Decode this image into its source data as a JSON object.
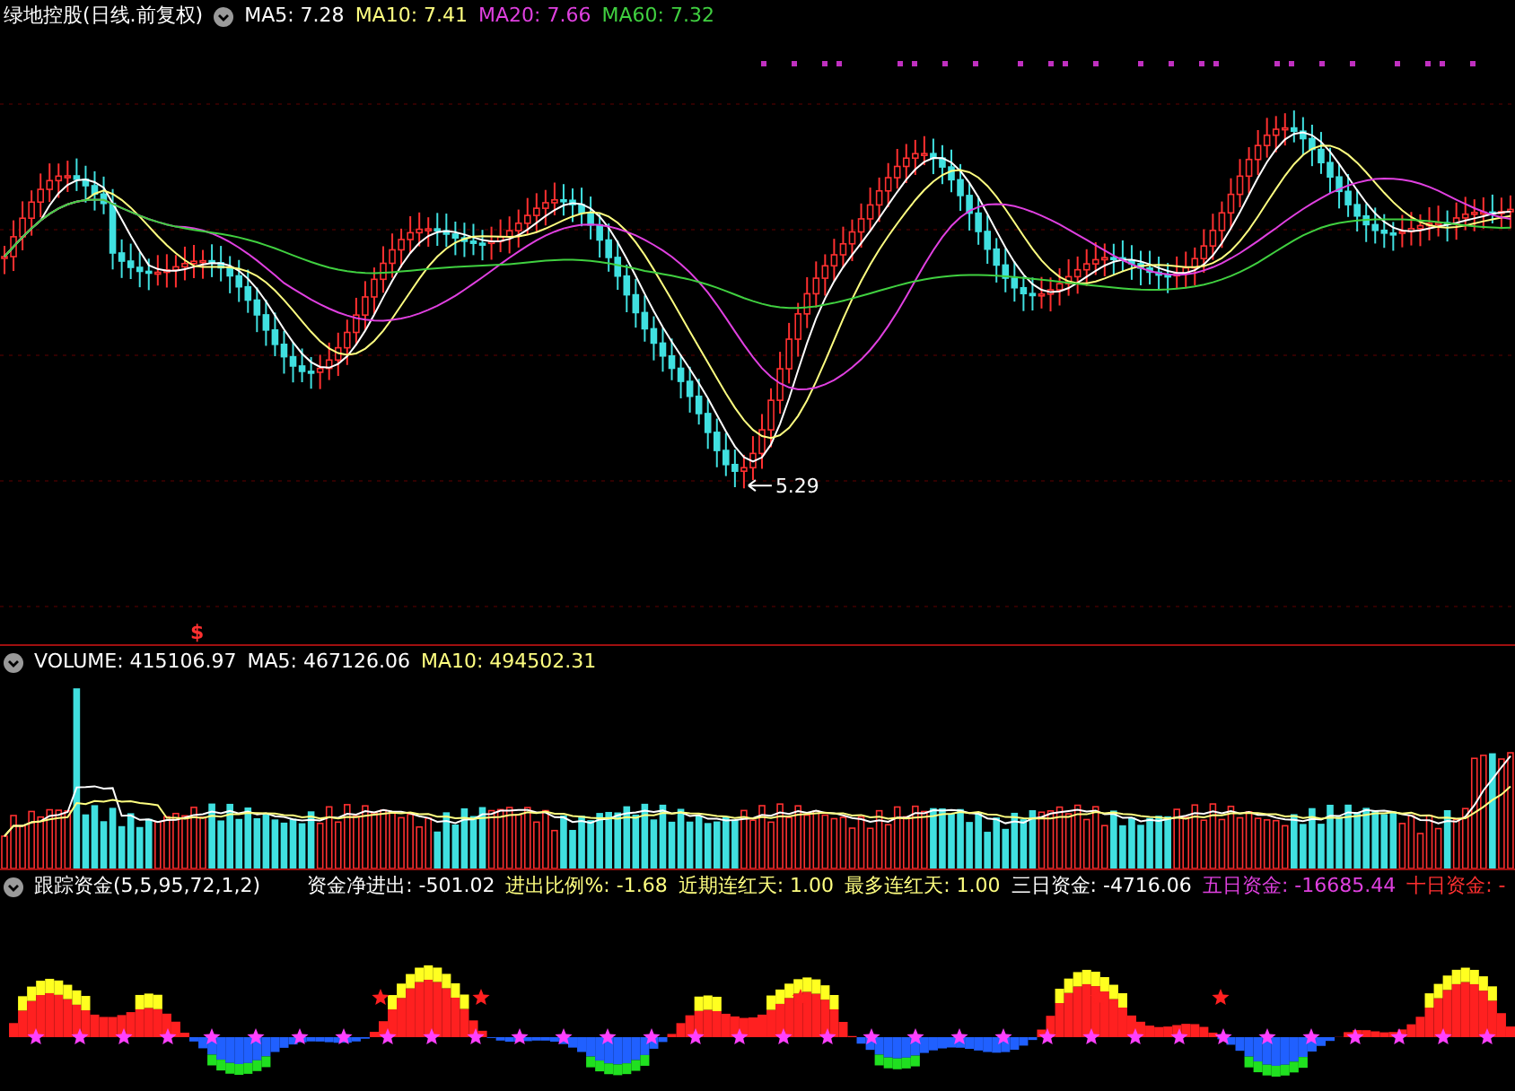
{
  "price_panel": {
    "title": "绿地控股(日线.前复权)",
    "indicators": [
      {
        "text": "MA5: 7.28",
        "color": "#ffffff"
      },
      {
        "text": "MA10: 7.41",
        "color": "#ffff80"
      },
      {
        "text": "MA20: 7.66",
        "color": "#e040e0"
      },
      {
        "text": "MA60: 7.32",
        "color": "#40d040"
      }
    ],
    "low_label": "5.29",
    "signal_mark": "$"
  },
  "volume_panel": {
    "indicators": [
      {
        "text": "VOLUME: 415106.97",
        "color": "#ffffff"
      },
      {
        "text": "MA5: 467126.06",
        "color": "#ffffff"
      },
      {
        "text": "MA10: 494502.31",
        "color": "#ffff80"
      }
    ]
  },
  "fund_panel": {
    "title": "跟踪资金(5,5,95,72,1,2)",
    "indicators": [
      {
        "text": "资金净进出: -501.02",
        "color": "#ffffff"
      },
      {
        "text": "进出比例%: -1.68",
        "color": "#ffff80"
      },
      {
        "text": "近期连红天: 1.00",
        "color": "#ffff80"
      },
      {
        "text": "最多连红天: 1.00",
        "color": "#ffff80"
      },
      {
        "text": "三日资金: -4716.06",
        "color": "#ffffff"
      },
      {
        "text": "五日资金: -16685.44",
        "color": "#e040e0"
      },
      {
        "text": "十日资金: -",
        "color": "#ff3030"
      }
    ]
  }
}
